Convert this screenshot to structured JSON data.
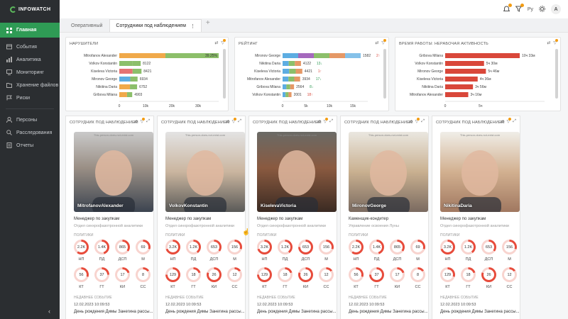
{
  "logo": {
    "text": "INFOWATCH"
  },
  "sidebar": {
    "items": [
      {
        "label": "Главная",
        "icon": "grid-icon",
        "active": true
      },
      {
        "label": "События",
        "icon": "events-icon"
      },
      {
        "label": "Аналитика",
        "icon": "analytics-icon"
      },
      {
        "label": "Мониторинг",
        "icon": "monitor-icon"
      },
      {
        "label": "Хранение файлов",
        "icon": "storage-icon"
      },
      {
        "label": "Риски",
        "icon": "risk-icon"
      },
      {
        "label": "Персоны",
        "icon": "persons-icon"
      },
      {
        "label": "Расследования",
        "icon": "investigation-icon"
      },
      {
        "label": "Отчеты",
        "icon": "reports-icon"
      }
    ],
    "collapse": "‹"
  },
  "topbar": {
    "lang": "Ру",
    "avatar": "A",
    "bell_icon": "bell-icon",
    "filter_icon": "funnel-icon",
    "gear_icon": "gear-icon"
  },
  "tabs": [
    {
      "label": "Оперативный",
      "active": false
    },
    {
      "label": "Сотрудники под наблюдением",
      "active": true,
      "menu": "⋮"
    }
  ],
  "tab_add": "+",
  "widgets": {
    "violators": {
      "title": "НАРУШИТЕЛИ",
      "rows": [
        {
          "name": "Mitrofanov Alexander",
          "value": "",
          "pct": "39.25%"
        },
        {
          "name": "Volkov Konstantin",
          "value": "8122"
        },
        {
          "name": "Kiseleva Victoria",
          "value": "8421"
        },
        {
          "name": "Mironov George",
          "value": "6934"
        },
        {
          "name": "Nikitina Daria",
          "value": "6752"
        },
        {
          "name": "Gribova Milana",
          "value": "4903"
        }
      ],
      "ticks": [
        "0",
        "10k",
        "20k",
        "30k"
      ]
    },
    "rating": {
      "title": "РЕЙТИНГ",
      "rows": [
        {
          "name": "Mironov George",
          "value": "1582",
          "trend": "2↑"
        },
        {
          "name": "Nikitina Daria",
          "value": "4122",
          "trend": "13↓"
        },
        {
          "name": "Kiseleva Victoria",
          "value": "4421",
          "trend": "1↑"
        },
        {
          "name": "Mitrofanov Alexander",
          "value": "3934",
          "trend": "17↓"
        },
        {
          "name": "Gribova Milana",
          "value": "2564",
          "trend": "8↓"
        },
        {
          "name": "Volkov Konstantin",
          "value": "2001",
          "trend": "18↑"
        }
      ],
      "ticks": [
        "0",
        "5k",
        "10k",
        "15k"
      ]
    },
    "worktime": {
      "title": "ВРЕМЯ РАБОТЫ: НЕРАБОЧАЯ АКТИВНОСТЬ",
      "rows": [
        {
          "name": "Gribova Milana",
          "value": "10ч 33м"
        },
        {
          "name": "Volkov Konstantin",
          "value": "5ч 30м"
        },
        {
          "name": "Mironov George",
          "value": "5ч 46м"
        },
        {
          "name": "Kiseleva Victoria",
          "value": "4ч 36м"
        },
        {
          "name": "Nikitina Daria",
          "value": "3ч 56м"
        },
        {
          "name": "Mitrofanov Alexander",
          "value": "3ч 16м"
        }
      ],
      "ticks": [
        "0",
        "5ч"
      ]
    }
  },
  "cards": [
    {
      "title": "СОТРУДНИК ПОД НАБЛЮДЕНИЕМ",
      "name": "MitrofanovAlexander",
      "watermark": "This-person-does-not-exist.com",
      "role": "Менеджер по закупкам",
      "dept": "Отдел синхрофазотронной аналитики",
      "policies_label": "ПОЛИТИКИ",
      "policies": [
        {
          "v": "2.2K",
          "c": "НП",
          "p": 0.6
        },
        {
          "v": "1.4K",
          "c": "ПД",
          "p": 0.45
        },
        {
          "v": "865",
          "c": "ДСП",
          "p": 0.35
        },
        {
          "v": "69",
          "c": "М",
          "p": 0.3
        },
        {
          "v": "56",
          "c": "КТ",
          "p": 0.3
        },
        {
          "v": "37",
          "c": "ГТ",
          "p": 0.25
        },
        {
          "v": "17",
          "c": "КИ",
          "p": 0.2
        },
        {
          "v": "8",
          "c": "СС",
          "p": 0.15
        }
      ],
      "recent_label": "НЕДАВНЕЕ СОБЫТИЕ",
      "recent_date": "12.02.2023  10:09:53",
      "recent_text": "День рождения Димы Занегина рассы..."
    },
    {
      "title": "СОТРУДНИК ПОД НАБЛЮДЕНИЕМ",
      "name": "VolkovKonstantin",
      "watermark": "This-person-does-not-exist.com",
      "role": "Менеджер по закупкам",
      "dept": "Отдел синхрофазотронной аналитики",
      "policies_label": "ПОЛИТИКИ",
      "policies": [
        {
          "v": "3.2K",
          "c": "НП",
          "p": 0.7
        },
        {
          "v": "1.2K",
          "c": "ПД",
          "p": 0.4
        },
        {
          "v": "653",
          "c": "ДСП",
          "p": 0.35
        },
        {
          "v": "156",
          "c": "М",
          "p": 0.3
        },
        {
          "v": "129",
          "c": "КТ",
          "p": 0.75
        },
        {
          "v": "18",
          "c": "ГТ",
          "p": 0.2
        },
        {
          "v": "26",
          "c": "КИ",
          "p": 0.8
        },
        {
          "v": "12",
          "c": "СС",
          "p": 0.15
        }
      ],
      "recent_label": "НЕДАВНЕЕ СОБЫТИЕ",
      "recent_date": "12.02.2023  10:09:53",
      "recent_text": "День рождения Димы Занегина рассы..."
    },
    {
      "title": "СОТРУДНИК ПОД НАБЛЮДЕНИЕМ",
      "name": "KiselevaVictoria",
      "watermark": "This-person-does-not-exist.com",
      "role": "Менеджер по закупкам",
      "dept": "Отдел синхрофазотронной аналитики",
      "policies_label": "ПОЛИТИКИ",
      "policies": [
        {
          "v": "3.2K",
          "c": "НП",
          "p": 0.7
        },
        {
          "v": "1.2K",
          "c": "ПД",
          "p": 0.4
        },
        {
          "v": "653",
          "c": "ДСП",
          "p": 0.75
        },
        {
          "v": "156",
          "c": "М",
          "p": 0.3
        },
        {
          "v": "129",
          "c": "КТ",
          "p": 0.75
        },
        {
          "v": "18",
          "c": "ГТ",
          "p": 0.2
        },
        {
          "v": "26",
          "c": "КИ",
          "p": 0.8
        },
        {
          "v": "12",
          "c": "СС",
          "p": 0.15
        }
      ],
      "recent_label": "НЕДАВНЕЕ СОБЫТИЕ",
      "recent_date": "12.02.2023  10:09:53",
      "recent_text": "День рождения Димы Занегина рассы..."
    },
    {
      "title": "СОТРУДНИК ПОД НАБЛЮДЕНИЕМ",
      "name": "MironovGeorge",
      "watermark": "This-person-does-not-exist.com",
      "role": "Каменщик-кондитер",
      "dept": "Управление освоения Луны",
      "policies_label": "ПОЛИТИКИ",
      "policies": [
        {
          "v": "2.2K",
          "c": "НП",
          "p": 0.6
        },
        {
          "v": "1.4K",
          "c": "ПД",
          "p": 0.45
        },
        {
          "v": "865",
          "c": "ДСП",
          "p": 0.35
        },
        {
          "v": "69",
          "c": "М",
          "p": 0.3
        },
        {
          "v": "56",
          "c": "КТ",
          "p": 0.3
        },
        {
          "v": "37",
          "c": "ГТ",
          "p": 0.75
        },
        {
          "v": "17",
          "c": "КИ",
          "p": 0.2
        },
        {
          "v": "8",
          "c": "СС",
          "p": 0.15
        }
      ],
      "recent_label": "НЕДАВНЕЕ СОБЫТИЕ",
      "recent_date": "12.02.2023  10:09:53",
      "recent_text": "День рождения Димы Занегина рассы..."
    },
    {
      "title": "СОТРУДНИК ПОД НАБЛЮДЕНИЕМ",
      "name": "NikitinaDaria",
      "watermark": "This-person-does-not-exist.com",
      "role": "Менеджер по закупкам",
      "dept": "Отдел синхрофазотронной аналитики",
      "policies_label": "ПОЛИТИКИ",
      "policies": [
        {
          "v": "3.2K",
          "c": "НП",
          "p": 0.7
        },
        {
          "v": "1.2K",
          "c": "ПД",
          "p": 0.4
        },
        {
          "v": "653",
          "c": "ДСП",
          "p": 0.35
        },
        {
          "v": "156",
          "c": "М",
          "p": 0.3
        },
        {
          "v": "129",
          "c": "КТ",
          "p": 0.3
        },
        {
          "v": "18",
          "c": "ГТ",
          "p": 0.2
        },
        {
          "v": "26",
          "c": "КИ",
          "p": 0.8
        },
        {
          "v": "12",
          "c": "СС",
          "p": 0.15
        }
      ],
      "recent_label": "НЕДАВНЕЕ СОБЫТИЕ",
      "recent_date": "12.02.2023  10:09:53",
      "recent_text": "День рождения Димы Занегина рассы..."
    }
  ],
  "colors": {
    "accent_green": "#2f9b55",
    "ring_red": "#e74c3c",
    "ring_bg": "#f8d4cf",
    "bar_orange": "#f0a94a",
    "bar_green": "#8cbf6a",
    "bar_red": "#d9473a"
  }
}
